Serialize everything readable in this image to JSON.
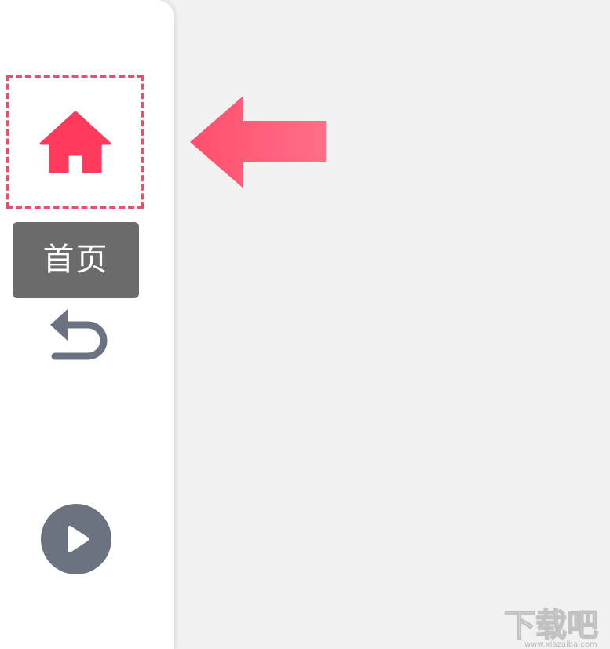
{
  "sidebar": {
    "home_tooltip": "首页",
    "icons": {
      "home": "home-icon",
      "back": "back-arrow-icon",
      "play": "play-icon"
    }
  },
  "annotation": {
    "pointer": "left-arrow-pointer"
  },
  "watermark": {
    "text": "下载吧",
    "url": "www.xiazaiba.com"
  },
  "colors": {
    "accent": "#ff3a5c",
    "highlight_border": "#e0536e",
    "tooltip_bg": "#6b6b6b",
    "icon_gray": "#6b7380",
    "background": "#f1f1f2",
    "sidebar_bg": "#ffffff"
  }
}
